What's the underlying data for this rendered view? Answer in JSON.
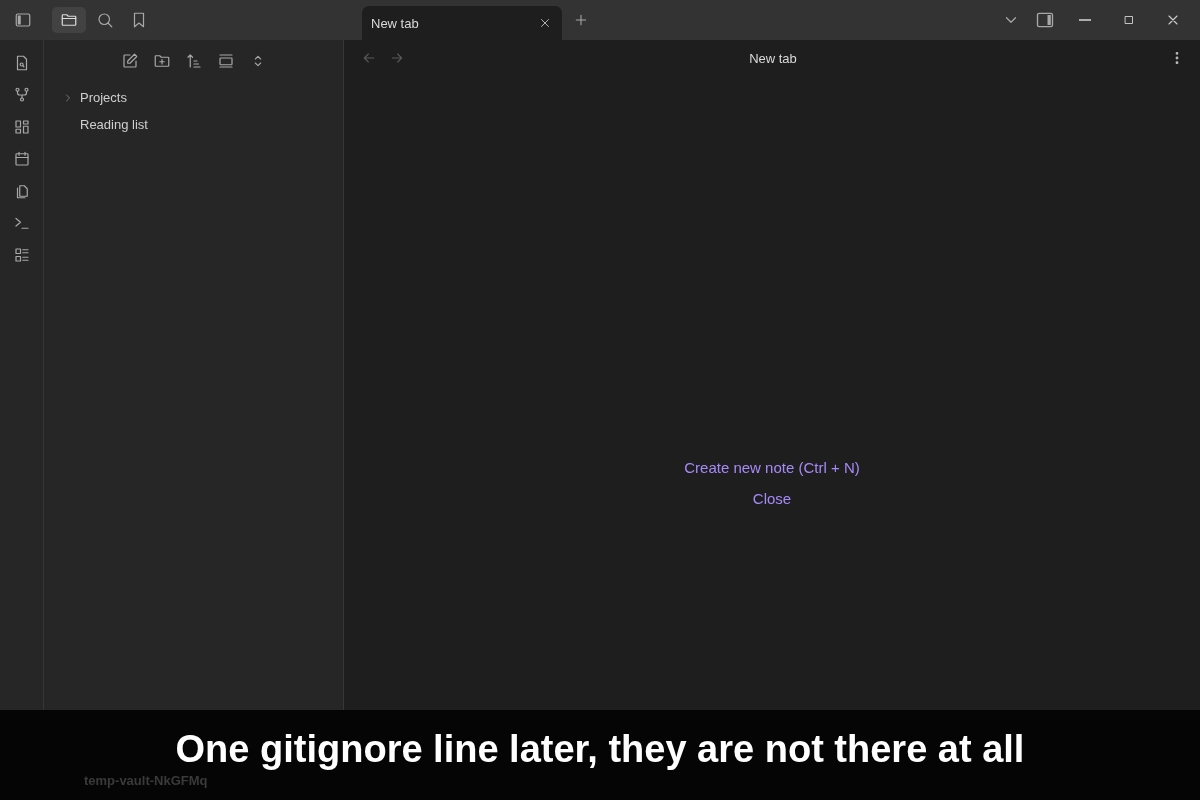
{
  "titlebar": {
    "sidebar_tabs": [
      {
        "kind": "files",
        "selected": true
      },
      {
        "kind": "search",
        "selected": false
      },
      {
        "kind": "bookmarks",
        "selected": false
      }
    ],
    "tabs": [
      {
        "label": "New tab",
        "selected": true
      }
    ]
  },
  "ribbon": {
    "items": [
      {
        "kind": "switcher"
      },
      {
        "kind": "graph"
      },
      {
        "kind": "canvas"
      },
      {
        "kind": "daily"
      },
      {
        "kind": "templates"
      },
      {
        "kind": "command"
      },
      {
        "kind": "bases"
      }
    ]
  },
  "file_explorer": {
    "items": [
      {
        "label": "Projects",
        "kind": "folder",
        "expanded": false
      },
      {
        "label": "Reading list",
        "kind": "file"
      }
    ]
  },
  "view": {
    "title": "New tab",
    "actions": [
      "Create new note (Ctrl + N)",
      "Close"
    ]
  },
  "status": {
    "vault_name": "temp-vault-NkGFMq"
  },
  "caption": "One gitignore line later, they are not there at all"
}
